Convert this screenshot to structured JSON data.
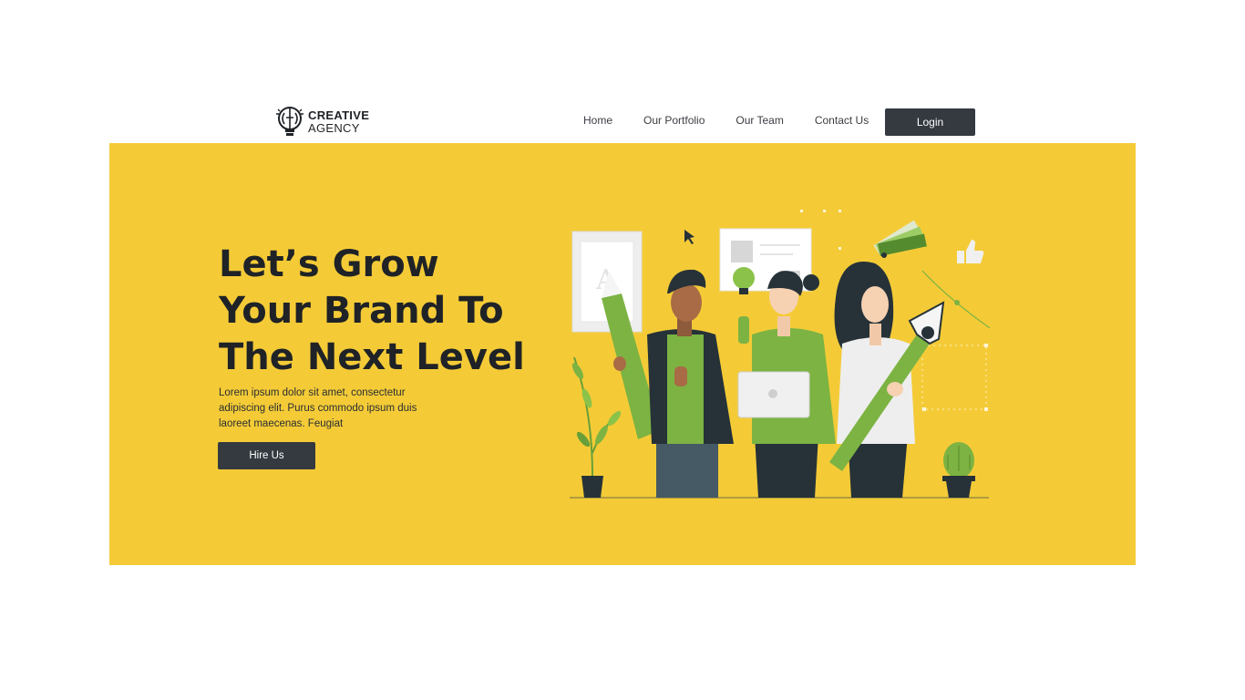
{
  "brand": {
    "line1": "CREATIVE",
    "line2": "AGENCY",
    "icon": "brain-bulb-icon"
  },
  "nav": {
    "items": [
      "Home",
      "Our Portfolio",
      "Our Team",
      "Contact Us"
    ],
    "login_label": "Login"
  },
  "hero": {
    "title": "Let’s Grow Your Brand To The Next Level",
    "description": "Lorem ipsum dolor sit amet, consectetur adipiscing elit. Purus commodo ipsum duis laoreet maecenas. Feugiat",
    "cta_label": "Hire Us"
  },
  "colors": {
    "hero_bg": "#f4cb37",
    "dark": "#343a40",
    "accent_green": "#7cb342"
  }
}
